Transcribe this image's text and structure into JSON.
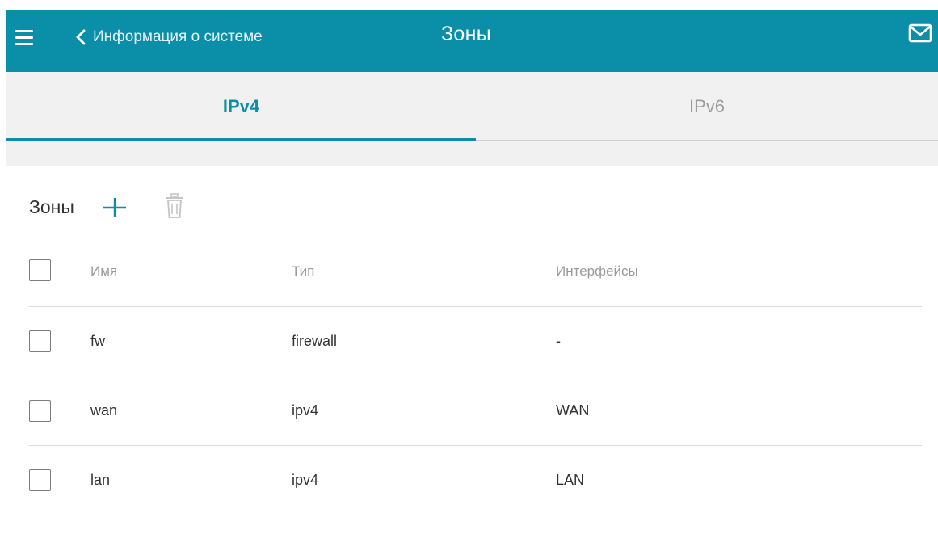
{
  "header": {
    "back_label": "Информация о системе",
    "title": "Зоны",
    "icons": {
      "menu": "hamburger-menu-icon",
      "back": "chevron-left-icon",
      "notifications": "mail-icon"
    },
    "colors": {
      "bar": "#0b8fa9",
      "text": "#ffffff"
    }
  },
  "tabs": [
    {
      "label": "IPv4",
      "active": true
    },
    {
      "label": "IPv6",
      "active": false
    }
  ],
  "section": {
    "title": "Зоны",
    "add_icon": "plus-icon",
    "delete_icon": "trash-icon"
  },
  "table": {
    "columns": [
      "Имя",
      "Тип",
      "Интерфейсы"
    ],
    "rows": [
      {
        "name": "fw",
        "type": "firewall",
        "interfaces": "-"
      },
      {
        "name": "wan",
        "type": "ipv4",
        "interfaces": "WAN"
      },
      {
        "name": "lan",
        "type": "ipv4",
        "interfaces": "LAN"
      }
    ]
  },
  "accent_color": "#0b8fa9"
}
